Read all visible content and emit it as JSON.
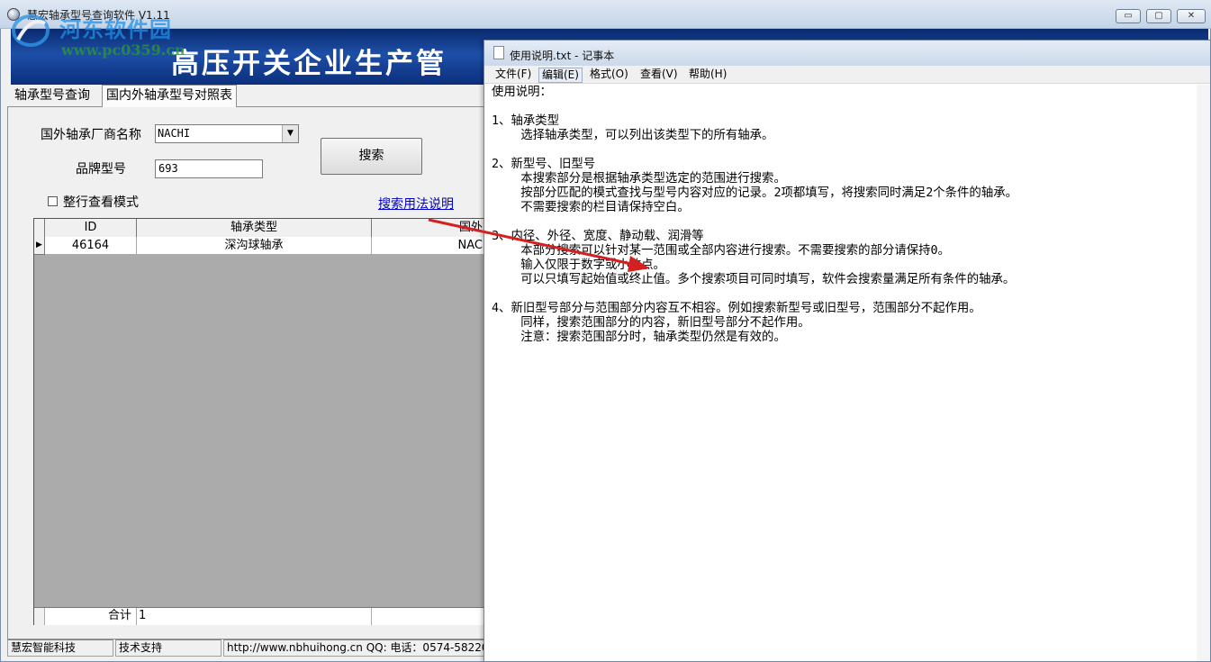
{
  "main_window": {
    "title": "慧宏轴承型号查询软件 V1.11",
    "controls": {
      "minimize": "▭",
      "maximize": "▢",
      "close": "✕"
    }
  },
  "watermark": {
    "site": "河东软件园",
    "url": "www.pc0359.cn"
  },
  "banner": {
    "title": "高压开关企业生产管"
  },
  "tabs": [
    {
      "label": "轴承型号查询"
    },
    {
      "label": "国内外轴承型号对照表"
    }
  ],
  "form": {
    "maker_label": "国外轴承厂商名称",
    "maker_value": "NACHI",
    "model_label": "品牌型号",
    "model_value": "693",
    "search_button": "搜索",
    "row_mode_label": "整行查看模式",
    "help_link": "搜索用法说明"
  },
  "grid": {
    "columns": [
      "ID",
      "轴承类型",
      "国外"
    ],
    "rows": [
      {
        "id": "46164",
        "type": "深沟球轴承",
        "foreign": "NAC"
      }
    ],
    "footer_label": "合计",
    "footer_value": "1"
  },
  "status_bar": {
    "company": "慧宏智能科技",
    "support": "技术支持",
    "contact": "http://www.nbhuihong.cn  QQ:  电话：0574-58220"
  },
  "notepad": {
    "title": "使用说明.txt - 记事本",
    "menu": [
      "文件(F)",
      "编辑(E)",
      "格式(O)",
      "查看(V)",
      "帮助(H)"
    ],
    "content": "使用说明：\n\n1、轴承类型\n    选择轴承类型，可以列出该类型下的所有轴承。\n\n2、新型号、旧型号\n    本搜索部分是根据轴承类型选定的范围进行搜索。\n    按部分匹配的模式查找与型号内容对应的记录。2项都填写，将搜索同时满足2个条件的轴承。\n    不需要搜索的栏目请保持空白。\n\n3、内径、外径、宽度、静动载、润滑等\n    本部分搜索可以针对某一范围或全部内容进行搜索。不需要搜索的部分请保持0。\n    输入仅限于数字或小数点。\n    可以只填写起始值或终止值。多个搜索项目可同时填写，软件会搜索量满足所有条件的轴承。\n\n4、新旧型号部分与范围部分内容互不相容。例如搜索新型号或旧型号，范围部分不起作用。\n    同样，搜索范围部分的内容，新旧型号部分不起作用。\n    注意：搜索范围部分时，轴承类型仍然是有效的。"
  },
  "colors": {
    "banner": "#1d4fa8",
    "annotation_arrow": "#d42020",
    "link": "#0000cc"
  }
}
